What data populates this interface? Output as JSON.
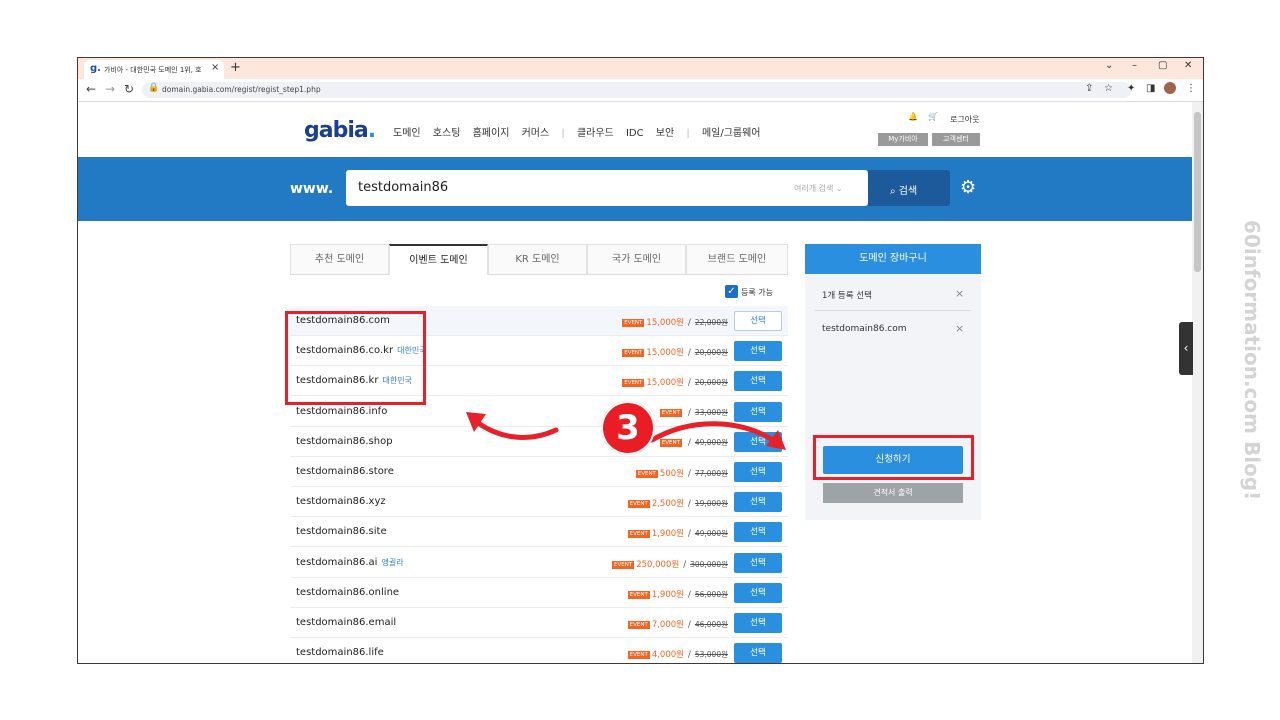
{
  "browser": {
    "tab_title": "가비아 - 대한민국 도메인 1위, 호",
    "tab_favicon": "g.",
    "tab_close": "×",
    "new_tab": "+",
    "url": "domain.gabia.com/regist/regist_step1.php",
    "controls": {
      "chevron": "⌄",
      "minimize": "–",
      "restore": "▢",
      "close": "✕"
    },
    "nav": {
      "back": "←",
      "forward": "→",
      "reload": "↻"
    },
    "toolbar_icons": {
      "share": "⇪",
      "star": "☆",
      "extension": "✦",
      "sidebar": "◨",
      "menu": "⋮"
    }
  },
  "site": {
    "logo": "gabia",
    "logo_dot": ".",
    "nav": [
      "도메인",
      "호스팅",
      "홈페이지",
      "커머스",
      "|",
      "클라우드",
      "IDC",
      "보안",
      "|",
      "메일/그룹웨어"
    ],
    "user": {
      "bell": "🔔",
      "cart_icon": "🛒",
      "logout": "로그아웃",
      "my_gabia": "My가비아",
      "support": "고객센터"
    },
    "search": {
      "prefix": "www.",
      "value": "testdomain86",
      "multi": "여러개 검색 ⌄",
      "button": "검색",
      "button_icon": "⌕",
      "settings_icon": "⚙"
    },
    "tabs": [
      "추천 도메인",
      "이벤트 도메인",
      "KR 도메인",
      "국가 도메인",
      "브랜드 도메인"
    ],
    "active_tab": 1,
    "available_label": "등록 가능",
    "checkmark": "✓",
    "domains": [
      {
        "name": "testdomain86.com",
        "country": "",
        "event": "EVENT",
        "price": "15,000원",
        "orig": "22,000원",
        "select": "선택",
        "selected": true
      },
      {
        "name": "testdomain86.co.kr",
        "country": "대한민국",
        "event": "EVENT",
        "price": "15,000원",
        "orig": "20,000원",
        "select": "선택",
        "selected": false
      },
      {
        "name": "testdomain86.kr",
        "country": "대한민국",
        "event": "EVENT",
        "price": "15,000원",
        "orig": "20,000원",
        "select": "선택",
        "selected": false
      },
      {
        "name": "testdomain86.info",
        "country": "",
        "event": "EVENT",
        "price": "",
        "orig": "33,000원",
        "select": "선택",
        "selected": false
      },
      {
        "name": "testdomain86.shop",
        "country": "",
        "event": "EVENT",
        "price": "",
        "orig": "49,000원",
        "select": "선택",
        "selected": false
      },
      {
        "name": "testdomain86.store",
        "country": "",
        "event": "EVENT",
        "price": "500원",
        "orig": "77,000원",
        "select": "선택",
        "selected": false
      },
      {
        "name": "testdomain86.xyz",
        "country": "",
        "event": "EVENT",
        "price": "2,500원",
        "orig": "19,000원",
        "select": "선택",
        "selected": false
      },
      {
        "name": "testdomain86.site",
        "country": "",
        "event": "EVENT",
        "price": "1,900원",
        "orig": "49,000원",
        "select": "선택",
        "selected": false
      },
      {
        "name": "testdomain86.ai",
        "country": "앵귈라",
        "event": "EVENT",
        "price": "250,000원",
        "orig": "300,000원",
        "select": "선택",
        "selected": false
      },
      {
        "name": "testdomain86.online",
        "country": "",
        "event": "EVENT",
        "price": "1,900원",
        "orig": "56,000원",
        "select": "선택",
        "selected": false
      },
      {
        "name": "testdomain86.email",
        "country": "",
        "event": "EVENT",
        "price": "7,000원",
        "orig": "46,000원",
        "select": "선택",
        "selected": false
      },
      {
        "name": "testdomain86.life",
        "country": "",
        "event": "EVENT",
        "price": "4,000원",
        "orig": "53,000원",
        "select": "선택",
        "selected": false
      }
    ],
    "cart": {
      "title": "도메인 장바구니",
      "count": "1개 등록 선택",
      "items": [
        "testdomain86.com"
      ],
      "remove": "×",
      "apply": "신청하기",
      "quote": "견적서 출력"
    },
    "side_toggle": "‹"
  },
  "annotation": {
    "step": "3",
    "colors": {
      "red": "#e8202a"
    }
  },
  "watermark": "60information.com Blog!"
}
